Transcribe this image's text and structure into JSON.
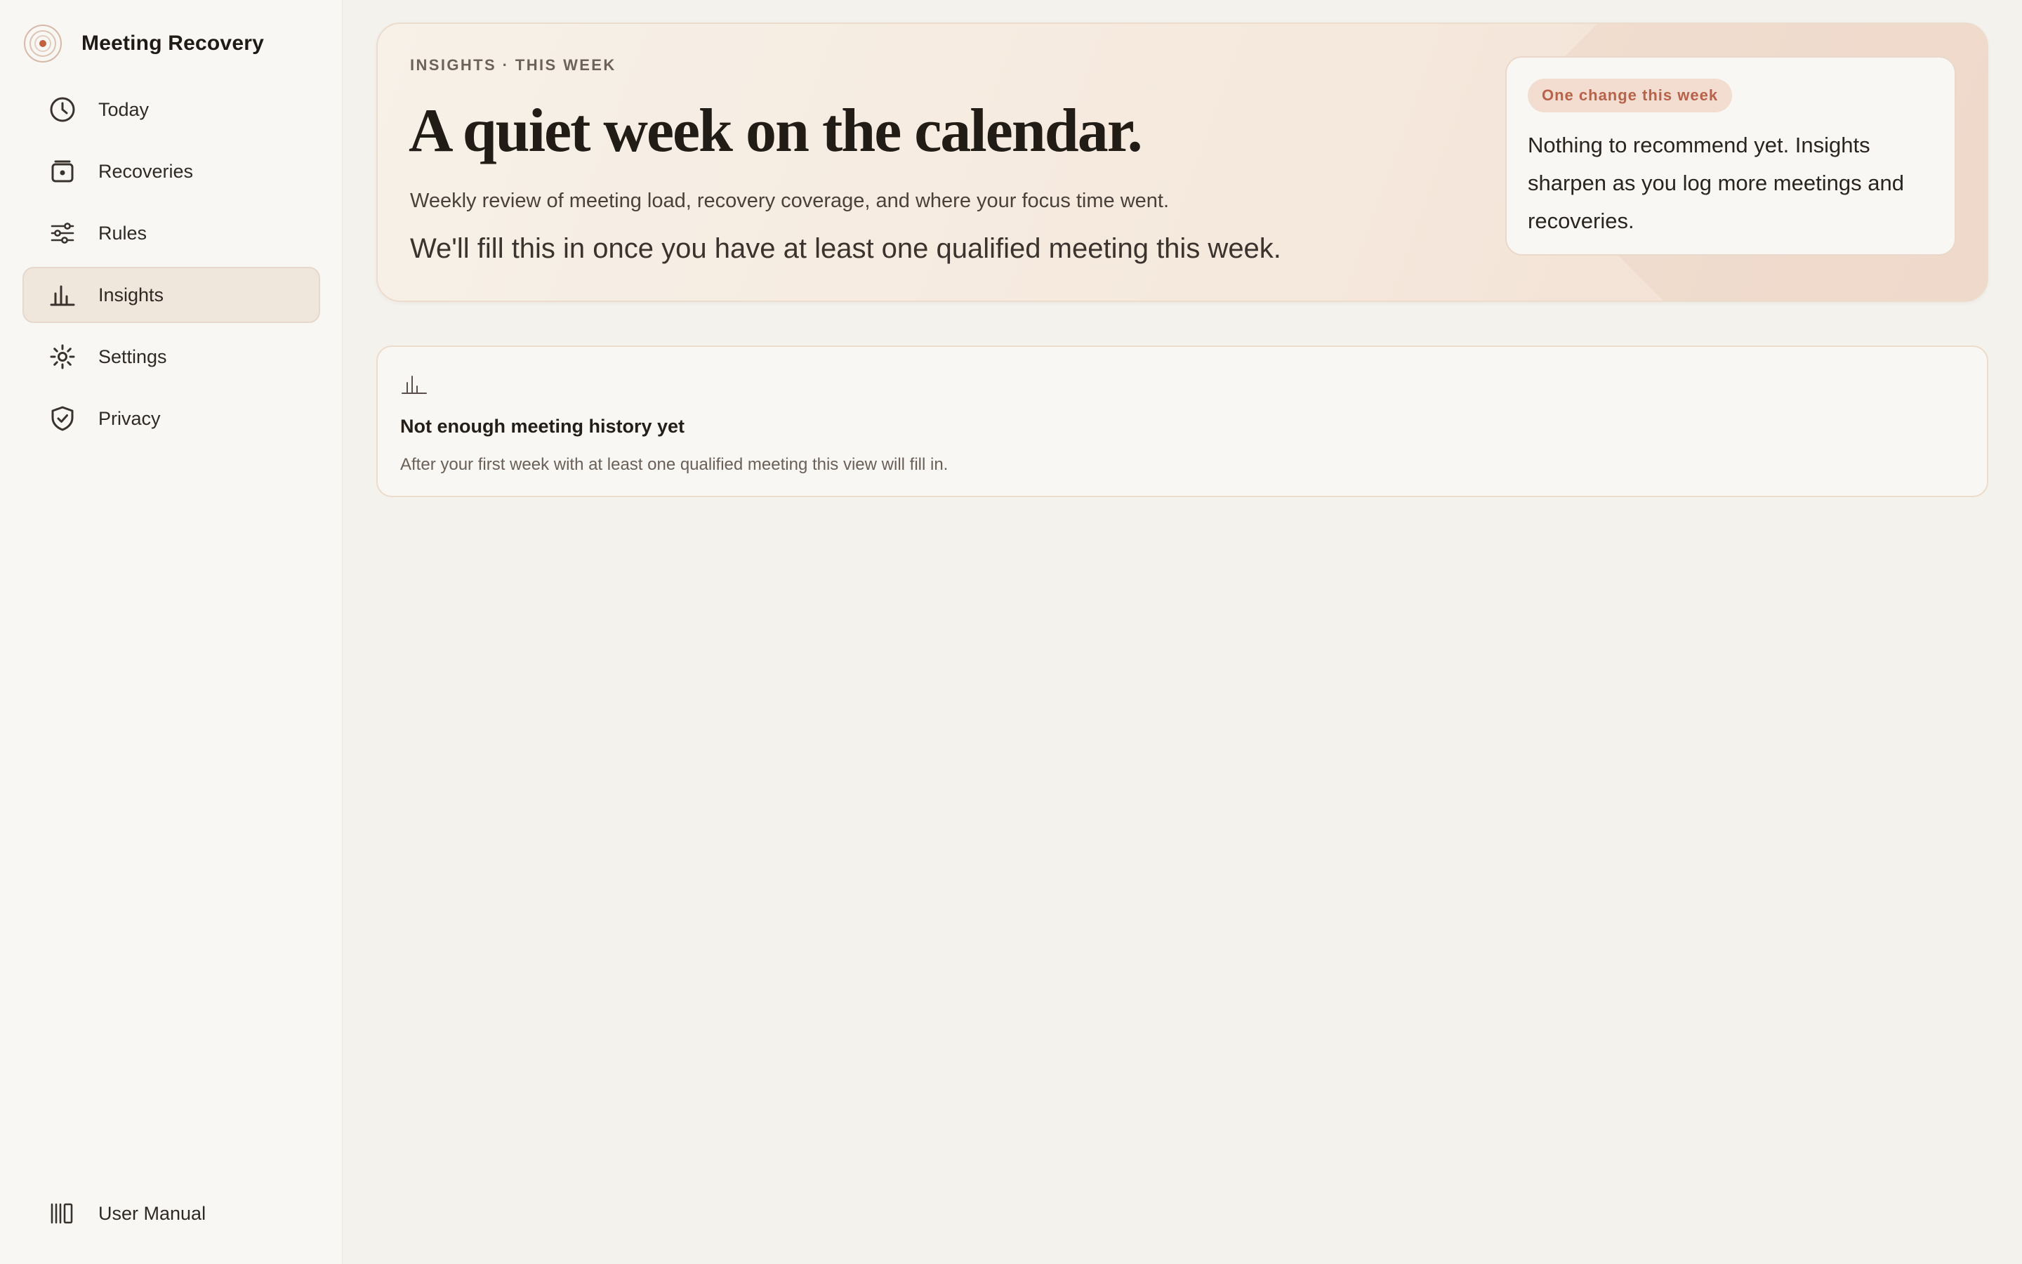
{
  "app": {
    "name": "Meeting Recovery"
  },
  "sidebar": {
    "items": [
      {
        "label": "Today",
        "icon": "clock-icon"
      },
      {
        "label": "Recoveries",
        "icon": "recoveries-icon"
      },
      {
        "label": "Rules",
        "icon": "sliders-icon"
      },
      {
        "label": "Insights",
        "icon": "bar-chart-icon",
        "active": true
      },
      {
        "label": "Settings",
        "icon": "gear-icon"
      },
      {
        "label": "Privacy",
        "icon": "shield-check-icon"
      }
    ],
    "footer": {
      "label": "User Manual",
      "icon": "library-icon"
    }
  },
  "hero": {
    "eyebrow": "INSIGHTS · THIS WEEK",
    "title": "A quiet week on the calendar.",
    "subtitle": "Weekly review of meeting load, recovery coverage, and where your focus time went.",
    "note": "We'll fill this in once you have at least one qualified meeting this week."
  },
  "change_card": {
    "badge": "One change this week",
    "text": "Nothing to recommend yet. Insights sharpen as you log more meetings and recoveries."
  },
  "empty_state": {
    "icon": "bar-chart-icon",
    "title": "Not enough meeting history yet",
    "description": "After your first week with at least one qualified meeting this view will fill in."
  },
  "colors": {
    "accent": "#c4603f",
    "badge_text": "#b8624a",
    "badge_bg": "#f2ddd0",
    "active_nav_bg": "#efe6dc"
  }
}
